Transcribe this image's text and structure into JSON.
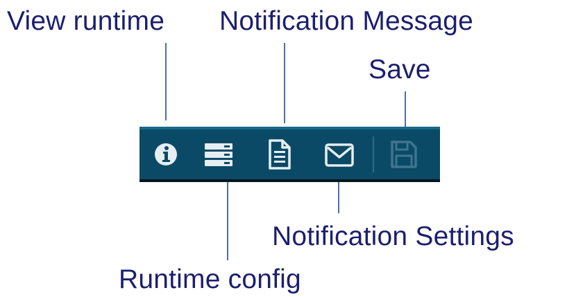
{
  "callouts": {
    "view_runtime": "View runtime",
    "notification_message": "Notification Message",
    "save": "Save",
    "notification_settings": "Notification Settings",
    "runtime_config": "Runtime config"
  },
  "toolbar": {
    "buttons": [
      {
        "name": "view-runtime",
        "icon": "info-icon"
      },
      {
        "name": "runtime-config",
        "icon": "server-icon"
      },
      {
        "name": "notification-message",
        "icon": "document-icon"
      },
      {
        "name": "notification-settings",
        "icon": "envelope-icon"
      },
      {
        "name": "save",
        "icon": "floppy-disk-icon",
        "state": "disabled"
      }
    ]
  },
  "colors": {
    "callout_text": "#1c1e6e",
    "leader_line": "#4a6fa5",
    "toolbar_bg": "#0b4a66",
    "icon": "#e6eef2",
    "icon_disabled": "#3f7590"
  }
}
